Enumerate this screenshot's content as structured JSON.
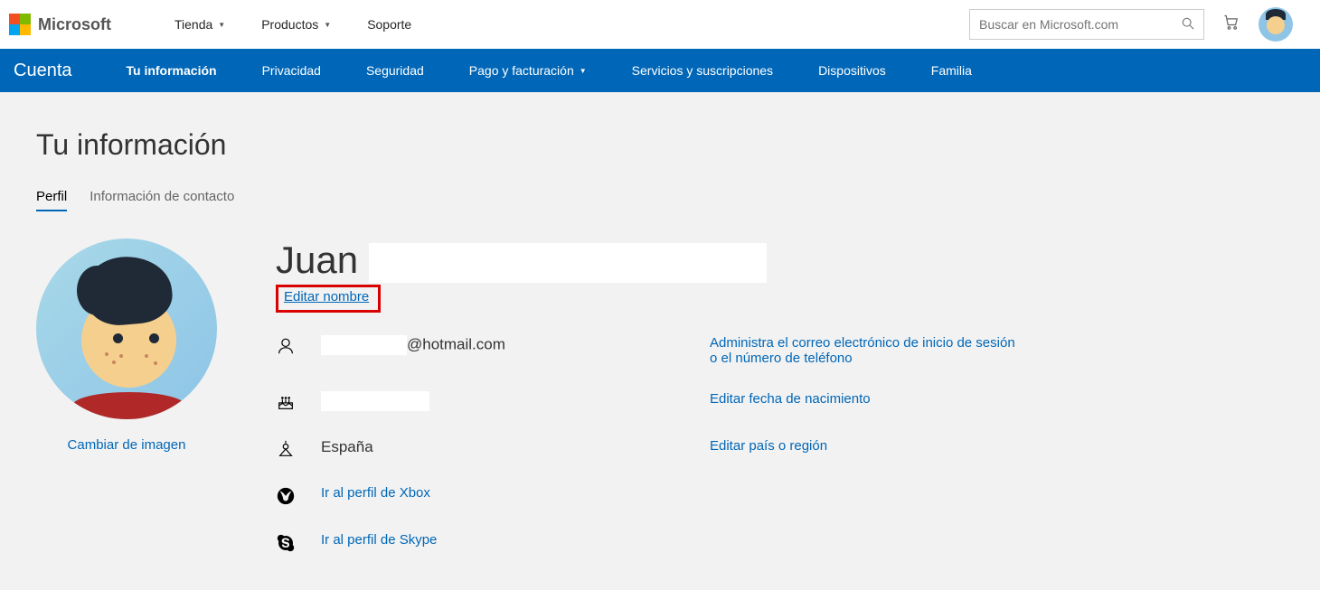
{
  "brand": "Microsoft",
  "topNav": {
    "links": [
      {
        "label": "Tienda",
        "hasDropdown": true
      },
      {
        "label": "Productos",
        "hasDropdown": true
      },
      {
        "label": "Soporte",
        "hasDropdown": false
      }
    ],
    "searchPlaceholder": "Buscar en Microsoft.com"
  },
  "blueNav": {
    "account": "Cuenta",
    "links": [
      {
        "label": "Tu información",
        "active": true,
        "hasDropdown": false
      },
      {
        "label": "Privacidad",
        "active": false,
        "hasDropdown": false
      },
      {
        "label": "Seguridad",
        "active": false,
        "hasDropdown": false
      },
      {
        "label": "Pago y facturación",
        "active": false,
        "hasDropdown": true
      },
      {
        "label": "Servicios y suscripciones",
        "active": false,
        "hasDropdown": false
      },
      {
        "label": "Dispositivos",
        "active": false,
        "hasDropdown": false
      },
      {
        "label": "Familia",
        "active": false,
        "hasDropdown": false
      }
    ]
  },
  "pageTitle": "Tu información",
  "tabs": {
    "profile": "Perfil",
    "contact": "Información de contacto"
  },
  "avatarSection": {
    "changeImage": "Cambiar de imagen"
  },
  "profile": {
    "nameVisible": "Juan",
    "editName": "Editar nombre",
    "emailSuffix": "@hotmail.com",
    "country": "España",
    "xboxLink": "Ir al perfil de Xbox",
    "skypeLink": "Ir al perfil de Skype",
    "actions": {
      "manageEmail": "Administra el correo electrónico de inicio de sesión o el número de teléfono",
      "editBirthdate": "Editar fecha de nacimiento",
      "editCountry": "Editar país o región"
    }
  }
}
